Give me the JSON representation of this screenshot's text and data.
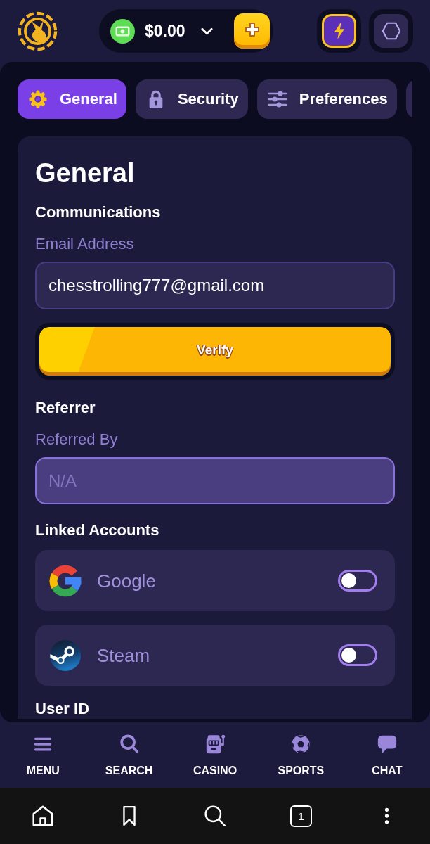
{
  "header": {
    "wallet": {
      "balance": "$0.00"
    }
  },
  "tabs": [
    {
      "label": "General",
      "kind": "gear",
      "selected": true
    },
    {
      "label": "Security",
      "kind": "lock",
      "selected": false
    },
    {
      "label": "Preferences",
      "kind": "sliders",
      "selected": false
    }
  ],
  "panel": {
    "title": "General",
    "communications": {
      "heading": "Communications",
      "email": {
        "label": "Email Address",
        "value": "chesstrolling777@gmail.com",
        "disabled": false
      },
      "verify_button": "Verify"
    },
    "referrer": {
      "heading": "Referrer",
      "referred_by": {
        "label": "Referred By",
        "placeholder": "N/A",
        "disabled": true
      }
    },
    "linked_accounts": {
      "heading": "Linked Accounts",
      "accounts": [
        {
          "name": "Google",
          "kind": "google",
          "linked": false
        },
        {
          "name": "Steam",
          "kind": "steam",
          "linked": false
        }
      ]
    },
    "user_id": {
      "heading": "User ID"
    }
  },
  "bottom_nav": [
    {
      "label": "MENU",
      "kind": "menu"
    },
    {
      "label": "SEARCH",
      "kind": "search"
    },
    {
      "label": "CASINO",
      "kind": "casino"
    },
    {
      "label": "SPORTS",
      "kind": "sports"
    },
    {
      "label": "CHAT",
      "kind": "chat"
    }
  ],
  "browser_bar": [
    {
      "kind": "home"
    },
    {
      "kind": "bookmark"
    },
    {
      "kind": "search"
    },
    {
      "kind": "tabs",
      "count": "1"
    },
    {
      "kind": "more"
    }
  ]
}
